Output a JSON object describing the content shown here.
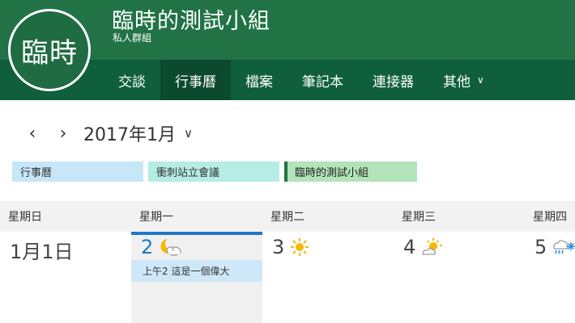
{
  "group": {
    "avatar_text": "臨時",
    "title": "臨時的測試小組",
    "subtitle": "私人群組"
  },
  "nav": {
    "items": [
      {
        "label": "交談"
      },
      {
        "label": "行事曆"
      },
      {
        "label": "檔案"
      },
      {
        "label": "筆記本"
      },
      {
        "label": "連接器"
      },
      {
        "label": "其他"
      }
    ],
    "active_index": 1
  },
  "month": {
    "label": "2017年1月"
  },
  "calendars": [
    {
      "label": "行事曆",
      "color": "#c7e6f8"
    },
    {
      "label": "衝刺站立會議",
      "color": "#b5ece4"
    },
    {
      "label": "臨時的測試小組",
      "color": "#b3e3b8"
    }
  ],
  "weekdays": [
    "星期日",
    "星期一",
    "星期二",
    "星期三",
    "星期四"
  ],
  "days": [
    {
      "label": "1月1日",
      "weather": ""
    },
    {
      "label": "2",
      "weather": "partly-cloudy-night-icon"
    },
    {
      "label": "3",
      "weather": "sunny-icon"
    },
    {
      "label": "4",
      "weather": "mostly-sunny-icon"
    },
    {
      "label": "5",
      "weather": "rain-snow-icon"
    }
  ],
  "events": [
    {
      "text": "上午2 這是一個偉大"
    }
  ],
  "colors": {
    "header": "#217346",
    "nav_band": "#0f5f3c",
    "today_accent": "#1e78c8"
  }
}
